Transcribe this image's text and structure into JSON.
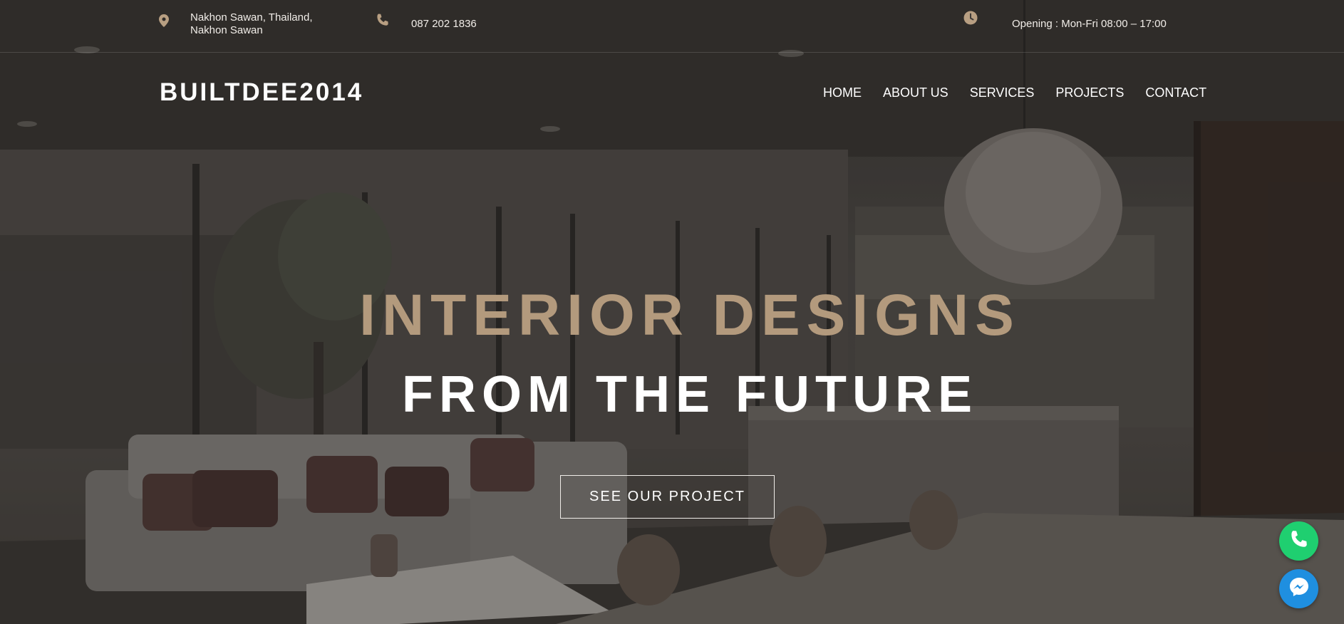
{
  "topbar": {
    "address_line1": "Nakhon Sawan, Thailand,",
    "address_line2": "Nakhon Sawan",
    "phone": "087 202 1836",
    "hours": "Opening : Mon-Fri 08:00 – 17:00",
    "icons": [
      "map-pin-icon",
      "phone-icon",
      "clock-icon"
    ]
  },
  "header": {
    "logo": "BUILTDEE2014",
    "nav": [
      "HOME",
      "ABOUT US",
      "SERVICES",
      "PROJECTS",
      "CONTACT"
    ]
  },
  "hero": {
    "line1": "INTERIOR DESIGNS",
    "line2": "FROM THE FUTURE",
    "cta_label": "SEE OUR PROJECT"
  },
  "floating_buttons": [
    "phone-call-icon",
    "messenger-icon"
  ],
  "colors": {
    "accent": "#b39a7d",
    "icon_accent": "#b89f82",
    "phone_fab": "#1fcf70",
    "messenger_fab": "#1f8fe0"
  }
}
